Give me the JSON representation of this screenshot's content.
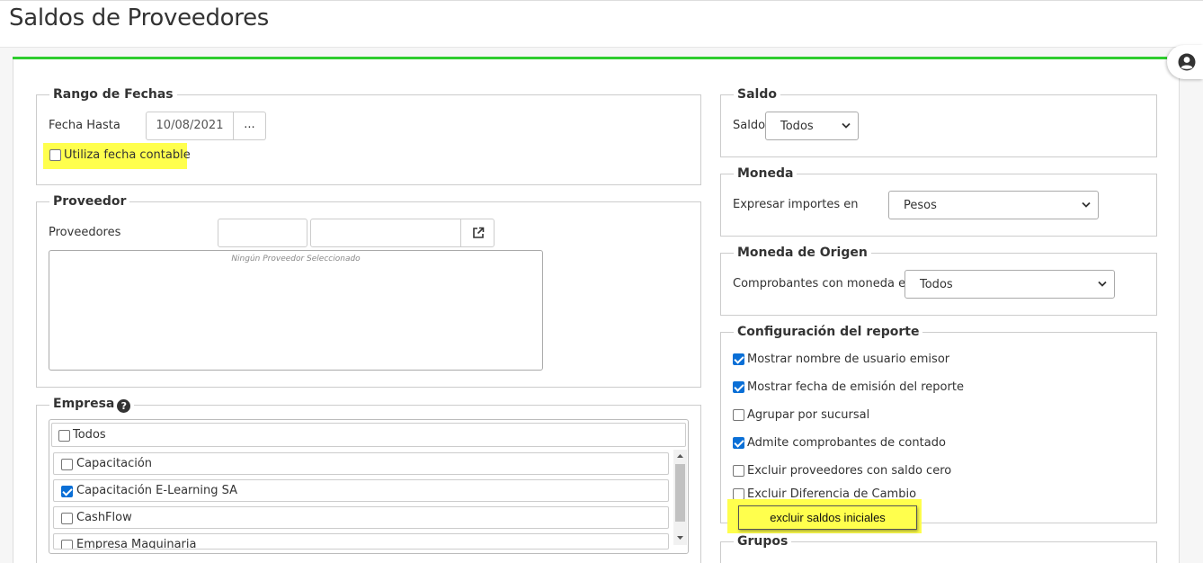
{
  "page": {
    "title": "Saldos de Proveedores"
  },
  "rango_fechas": {
    "legend": "Rango de Fechas",
    "fecha_hasta_label": "Fecha Hasta",
    "fecha_hasta_value": "10/08/2021",
    "picker_label": "...",
    "fecha_contable_label": "Utiliza fecha contable",
    "fecha_contable_checked": false
  },
  "proveedor": {
    "legend": "Proveedor",
    "proveedores_label": "Proveedores",
    "code_value": "",
    "name_value": "",
    "empty_message": "Ningún Proveedor Seleccionado"
  },
  "empresa": {
    "legend": "Empresa",
    "todos_label": "Todos",
    "items": [
      {
        "label": "Capacitación",
        "checked": false
      },
      {
        "label": "Capacitación E-Learning SA",
        "checked": true
      },
      {
        "label": "CashFlow",
        "checked": false
      },
      {
        "label": "Empresa Maquinaria",
        "checked": false
      }
    ]
  },
  "saldo": {
    "legend": "Saldo",
    "label": "Saldo",
    "selected": "Todos"
  },
  "moneda": {
    "legend": "Moneda",
    "label": "Expresar importes en",
    "selected": "Pesos"
  },
  "moneda_origen": {
    "legend": "Moneda de Origen",
    "label": "Comprobantes con moneda en",
    "selected": "Todos"
  },
  "configuracion": {
    "legend": "Configuración del reporte",
    "options": [
      {
        "label": "Mostrar nombre de usuario emisor",
        "checked": true
      },
      {
        "label": "Mostrar fecha de emisión del reporte",
        "checked": true
      },
      {
        "label": "Agrupar por sucursal",
        "checked": false
      },
      {
        "label": "Admite comprobantes de contado",
        "checked": true
      },
      {
        "label": "Excluir proveedores con saldo cero",
        "checked": false
      },
      {
        "label": "Excluir Diferencia de Cambio",
        "checked": false
      }
    ],
    "excluir_saldos_label": "excluir saldos iniciales"
  },
  "grupos": {
    "legend": "Grupos"
  },
  "colors": {
    "accent_green": "#2ecc2e",
    "highlight_yellow": "#ffff4d",
    "checkbox_blue": "#0a6fd6"
  }
}
